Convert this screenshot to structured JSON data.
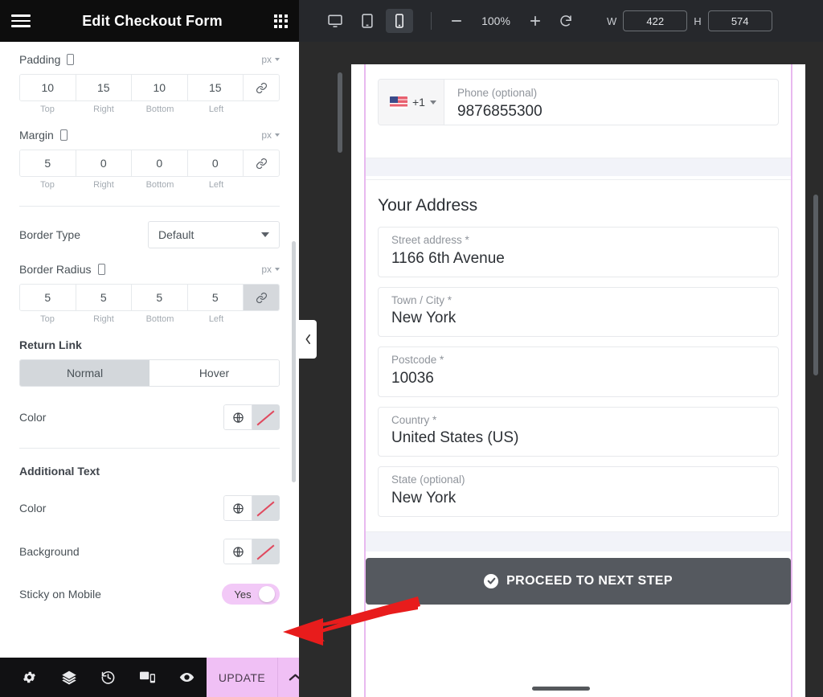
{
  "panel": {
    "header": {
      "title": "Edit Checkout Form",
      "menu_icon": "hamburger-icon",
      "apps_icon": "grid-apps-icon"
    },
    "controls": {
      "padding": {
        "label": "Padding",
        "unit": "px",
        "values": [
          "10",
          "15",
          "10",
          "15"
        ],
        "side_labels": [
          "Top",
          "Right",
          "Bottom",
          "Left"
        ],
        "linked": false
      },
      "margin": {
        "label": "Margin",
        "unit": "px",
        "values": [
          "5",
          "0",
          "0",
          "0"
        ],
        "side_labels": [
          "Top",
          "Right",
          "Bottom",
          "Left"
        ],
        "linked": false
      },
      "border_type": {
        "label": "Border Type",
        "value": "Default"
      },
      "border_radius": {
        "label": "Border Radius",
        "unit": "px",
        "values": [
          "5",
          "5",
          "5",
          "5"
        ],
        "side_labels": [
          "Top",
          "Right",
          "Bottom",
          "Left"
        ],
        "linked": true
      },
      "return_link": {
        "section": "Return Link",
        "tabs": [
          "Normal",
          "Hover"
        ],
        "active_tab": "Normal",
        "color_label": "Color"
      },
      "additional_text": {
        "section": "Additional Text",
        "color_label": "Color",
        "background_label": "Background"
      },
      "sticky_on_mobile": {
        "label": "Sticky on Mobile",
        "value": "Yes",
        "enabled": true
      }
    },
    "footer": {
      "icons": [
        "gear-icon",
        "layers-icon",
        "history-icon",
        "responsive-icon",
        "preview-eye-icon"
      ],
      "update_label": "UPDATE",
      "update_arrow_icon": "chevron-up-icon"
    }
  },
  "toolbar": {
    "devices": [
      {
        "name": "desktop",
        "icon": "desktop-icon",
        "active": false
      },
      {
        "name": "tablet",
        "icon": "tablet-icon",
        "active": false
      },
      {
        "name": "mobile",
        "icon": "mobile-icon",
        "active": true
      }
    ],
    "zoom_out_icon": "minus-icon",
    "zoom_value": "100%",
    "zoom_in_icon": "plus-icon",
    "reset_icon": "rotate-ccw-icon",
    "width_label": "W",
    "width_value": "422",
    "height_label": "H",
    "height_value": "574"
  },
  "preview": {
    "phone_field": {
      "country_code": "+1",
      "flag": "us-flag-icon",
      "label": "Phone (optional)",
      "value": "9876855300"
    },
    "address_section": {
      "heading": "Your Address",
      "fields": [
        {
          "label": "Street address *",
          "value": "1166 6th Avenue"
        },
        {
          "label": "Town / City *",
          "value": "New York"
        },
        {
          "label": "Postcode *",
          "value": "10036"
        },
        {
          "label": "Country *",
          "value": "United States (US)"
        },
        {
          "label": "State (optional)",
          "value": "New York"
        }
      ]
    },
    "proceed_button": {
      "label": "PROCEED TO NEXT STEP",
      "icon": "check-circle-icon"
    }
  },
  "collapse_handle_icon": "chevron-left-icon",
  "annotation": {
    "arrow_icon": "red-arrow-pointing-left",
    "color": "#e81c1c"
  },
  "colors": {
    "header_bg": "#0d0d0d",
    "update_bg": "#f0c0f5",
    "toggle_on": "#f2c9f7",
    "accent_pink": "#e8b9ef",
    "preview_bg": "#2b2b2b",
    "toolbar_bg": "#26282c",
    "button_bg": "#55595f"
  }
}
